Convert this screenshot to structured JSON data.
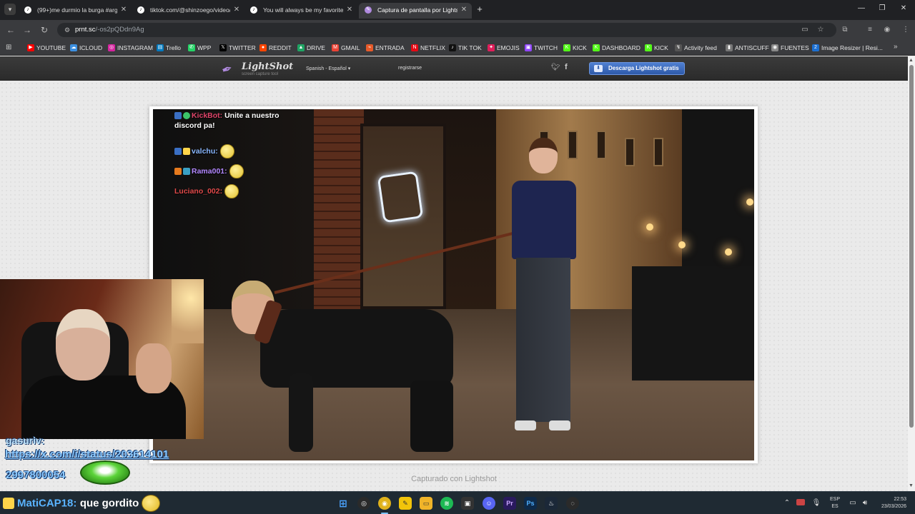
{
  "browser": {
    "tabs": [
      {
        "title": "(99+)me durmio la burga #arge",
        "icon": "tiktok-icon"
      },
      {
        "title": "tiktok.com/@shinzoego/video/",
        "icon": "tiktok-icon"
      },
      {
        "title": "You will always be my favorite",
        "icon": "tiktok-icon"
      },
      {
        "title": "Captura de pantalla por Lightsh",
        "icon": "lightshot-icon",
        "active": true
      }
    ],
    "url_host": "prnt.sc",
    "url_path": "/-os2pQDdn9Ag"
  },
  "bookmarks": [
    {
      "label": "YOUTUBE",
      "color": "#ff0000"
    },
    {
      "label": "ICLOUD",
      "color": "#3c8fe0"
    },
    {
      "label": "INSTAGRAM",
      "color": "#d6249f"
    },
    {
      "label": "Trello",
      "color": "#0079bf"
    },
    {
      "label": "WPP",
      "color": "#25d366"
    },
    {
      "label": "TWITTER",
      "color": "#000000"
    },
    {
      "label": "REDDIT",
      "color": "#ff4500"
    },
    {
      "label": "DRIVE",
      "color": "#1fa463"
    },
    {
      "label": "GMAIL",
      "color": "#ea4335"
    },
    {
      "label": "ENTRADA",
      "color": "#e65a2a"
    },
    {
      "label": "NETFLIX",
      "color": "#e50914"
    },
    {
      "label": "TIK TOK",
      "color": "#111111"
    },
    {
      "label": "EMOJIS",
      "color": "#e01e5a"
    },
    {
      "label": "TWITCH",
      "color": "#9146ff"
    },
    {
      "label": "KICK",
      "color": "#53fc18"
    },
    {
      "label": "DASHBOARD",
      "color": "#53fc18"
    },
    {
      "label": "KICK",
      "color": "#53fc18"
    },
    {
      "label": "Activity feed",
      "color": "#555555"
    },
    {
      "label": "ANTISCUFF",
      "color": "#777777"
    },
    {
      "label": "FUENTES",
      "color": "#888888"
    },
    {
      "label": "Image Resizer | Resi...",
      "color": "#1c6fd1"
    }
  ],
  "lightshot": {
    "logo": "LightShot",
    "tagline": "screen capture tool",
    "language": "Spanish - Español",
    "register": "registrarse",
    "download": "Descarga Lightshot gratis",
    "caption": "Capturado con Lightshot"
  },
  "chat": [
    {
      "user": "KickBot:",
      "message": "Unite a nuestro",
      "message2": "discord pa!",
      "color": "#e0456a"
    },
    {
      "user": "valchu:",
      "message": "",
      "color": "#8ab8ff"
    },
    {
      "user": "Rama001:",
      "message": "",
      "color": "#b388ff"
    },
    {
      "user": "Luciano_002:",
      "message": "",
      "color": "#e04a4a"
    }
  ],
  "overlay": {
    "user": "gasuriv:",
    "link": "https://x.com/i/status/203614101",
    "number": "2997800054"
  },
  "taskbar_chat": {
    "user": "MatiCAP18:",
    "message": "que gordito"
  },
  "tray": {
    "lang_top": "ESP",
    "lang_bottom": "ES",
    "time": "22:53",
    "date": "23/03/2026"
  }
}
